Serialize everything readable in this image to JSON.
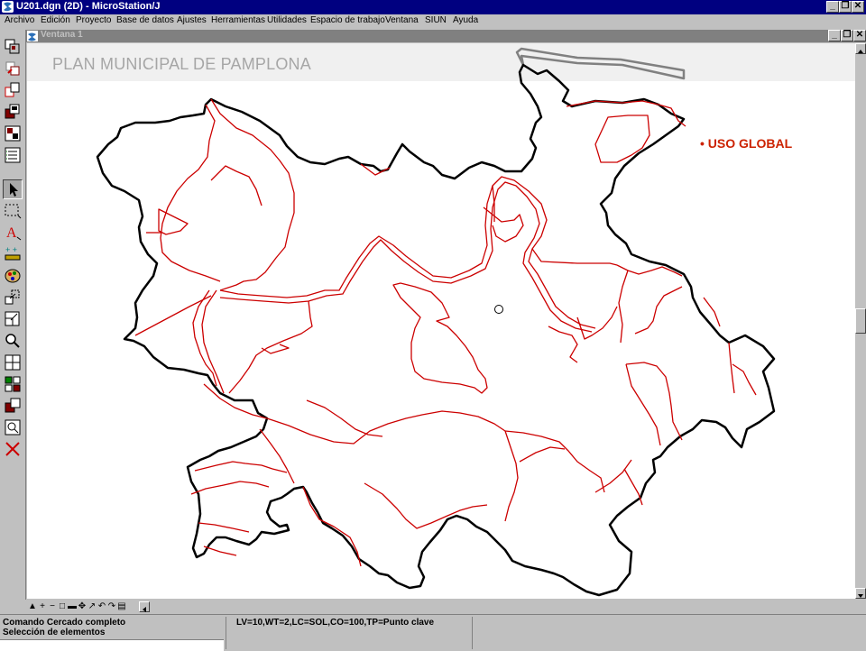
{
  "app": {
    "title": "U201.dgn (2D) - MicroStation/J",
    "caption_buttons": [
      "_",
      "❐",
      "✕"
    ]
  },
  "menu": {
    "items": [
      {
        "label": "Archivo"
      },
      {
        "label": "Edición"
      },
      {
        "label": "Proyecto"
      },
      {
        "label": "Base de datos"
      },
      {
        "label": "Ajustes"
      },
      {
        "label": "Herramientas"
      },
      {
        "label": "Utilidades"
      },
      {
        "label": "Espacio de trabajo"
      },
      {
        "label": "Ventana"
      },
      {
        "label": "SIUN"
      },
      {
        "label": "Ayuda"
      }
    ]
  },
  "view_window": {
    "title": "Ventana 1",
    "caption_buttons": [
      "_",
      "❐",
      "✕"
    ]
  },
  "drawing": {
    "banner_title": "PLAN MUNICIPAL DE PAMPLONA",
    "legend_label": "• USO GLOBAL",
    "colors": {
      "boundary": "#000000",
      "zones": "#cc0000",
      "highlight_path": "#808080",
      "banner_bg": "#f0f0f0",
      "legend_text": "#cc2200",
      "title_text": "#a6a6a6"
    }
  },
  "tools": [
    {
      "name": "tool-main-icon"
    },
    {
      "name": "tool-reference-icon"
    },
    {
      "name": "tool-copy-icon"
    },
    {
      "name": "tool-fence-icon"
    },
    {
      "name": "tool-cells-icon"
    },
    {
      "name": "tool-list-icon"
    },
    {
      "name": "tool-select-element-icon"
    },
    {
      "name": "tool-fence-place-icon"
    },
    {
      "name": "tool-text-icon"
    },
    {
      "name": "tool-points-icon"
    },
    {
      "name": "tool-palette-icon"
    },
    {
      "name": "tool-move-icon"
    },
    {
      "name": "tool-scale-icon"
    },
    {
      "name": "tool-zoom-icon"
    },
    {
      "name": "tool-grid-icon"
    },
    {
      "name": "tool-group-icon"
    },
    {
      "name": "tool-view-icon"
    },
    {
      "name": "tool-measure-icon"
    },
    {
      "name": "tool-delete-icon"
    }
  ],
  "view_controls": [
    "▲",
    "+",
    "−",
    "□",
    "▬",
    "✥",
    "↗",
    "↶",
    "↷",
    "▤"
  ],
  "status": {
    "command": "Comando Cercado completo",
    "prompt": "Selección de elementos",
    "attributes": "LV=10,WT=2,LC=SOL,CO=100,TP=Punto clave"
  }
}
